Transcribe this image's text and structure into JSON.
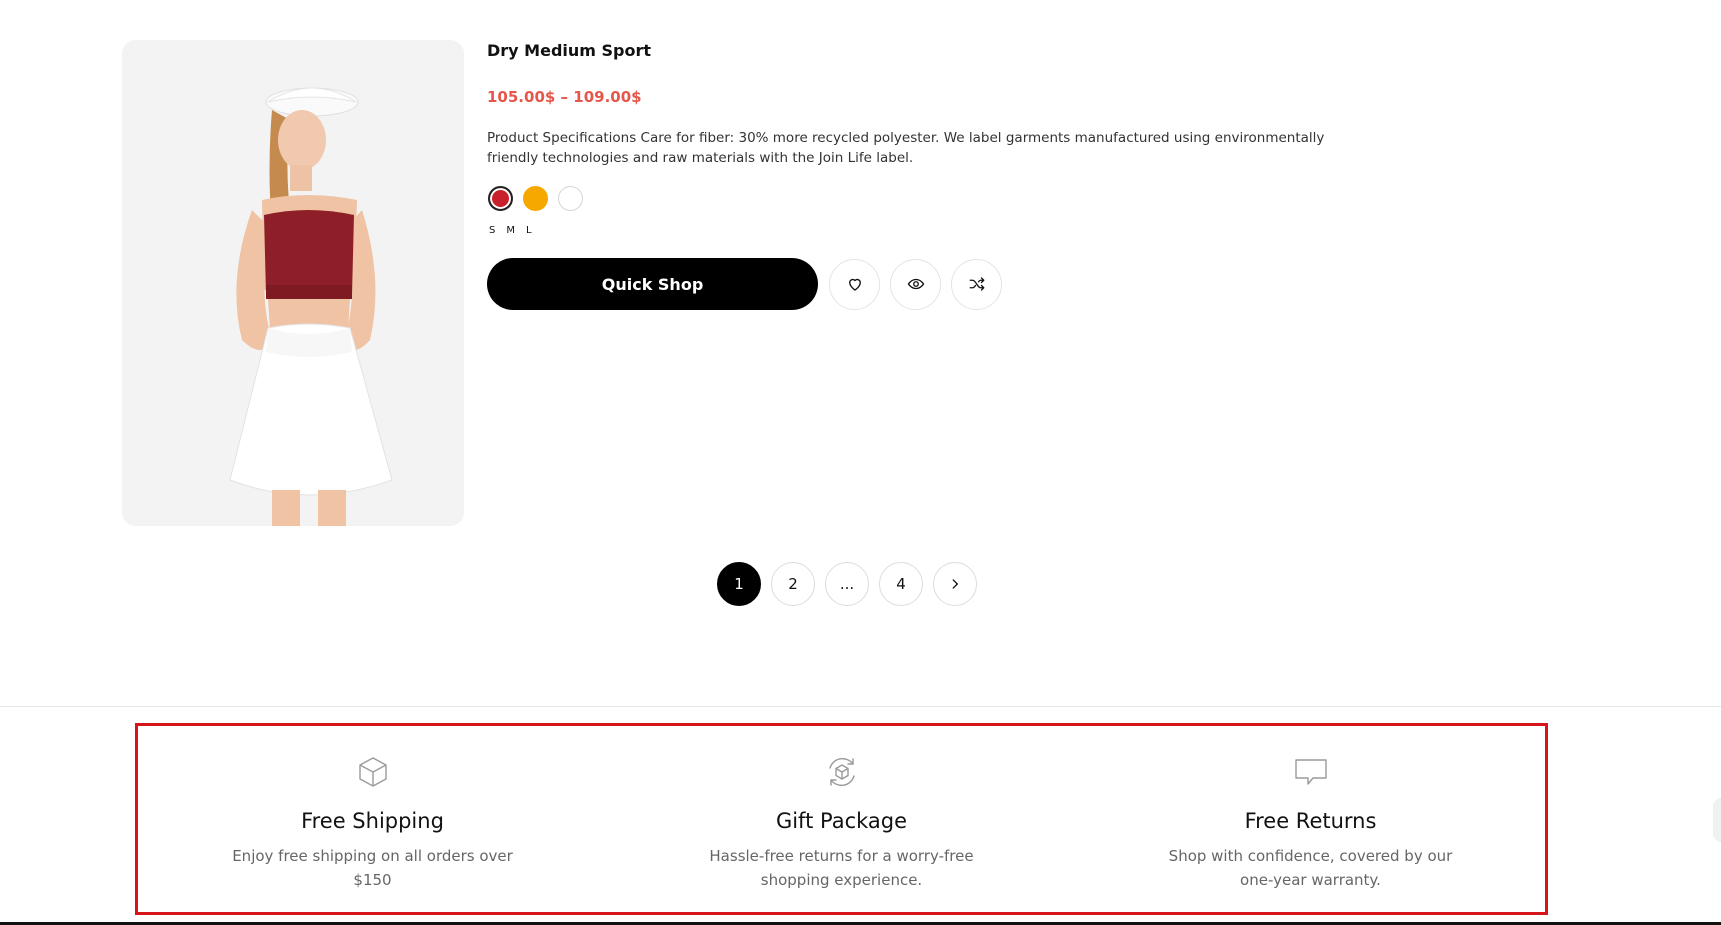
{
  "product": {
    "title": "Dry Medium Sport",
    "price": "105.00$ – 109.00$",
    "description": "Product Specifications Care for fiber: 30% more recycled polyester. We label garments manufactured using environmentally friendly technologies and raw materials with the Join Life label.",
    "swatches": [
      {
        "name": "red",
        "color": "#c8202c",
        "selected": true
      },
      {
        "name": "yellow",
        "color": "#f6a800",
        "selected": false
      },
      {
        "name": "white",
        "color": "#ffffff",
        "selected": false
      }
    ],
    "sizes": [
      "S",
      "M",
      "L"
    ],
    "quick_shop_label": "Quick Shop",
    "action_icons": [
      "heart-icon",
      "eye-icon",
      "shuffle-icon"
    ]
  },
  "pagination": {
    "pages": [
      "1",
      "2",
      "...",
      "4"
    ],
    "active_page": "1",
    "next_icon": "chevron-right-icon"
  },
  "features": [
    {
      "icon": "box-icon",
      "title": "Free Shipping",
      "description": "Enjoy free shipping on all orders over $150"
    },
    {
      "icon": "box-refresh-icon",
      "title": "Gift Package",
      "description": "Hassle-free returns for a worry-free shopping experience."
    },
    {
      "icon": "chat-bubble-icon",
      "title": "Free Returns",
      "description": "Shop with confidence, covered by our one-year warranty."
    }
  ],
  "colors": {
    "price": "#e6574b",
    "primary_button": "#000000",
    "highlight_border": "#d7141a"
  }
}
